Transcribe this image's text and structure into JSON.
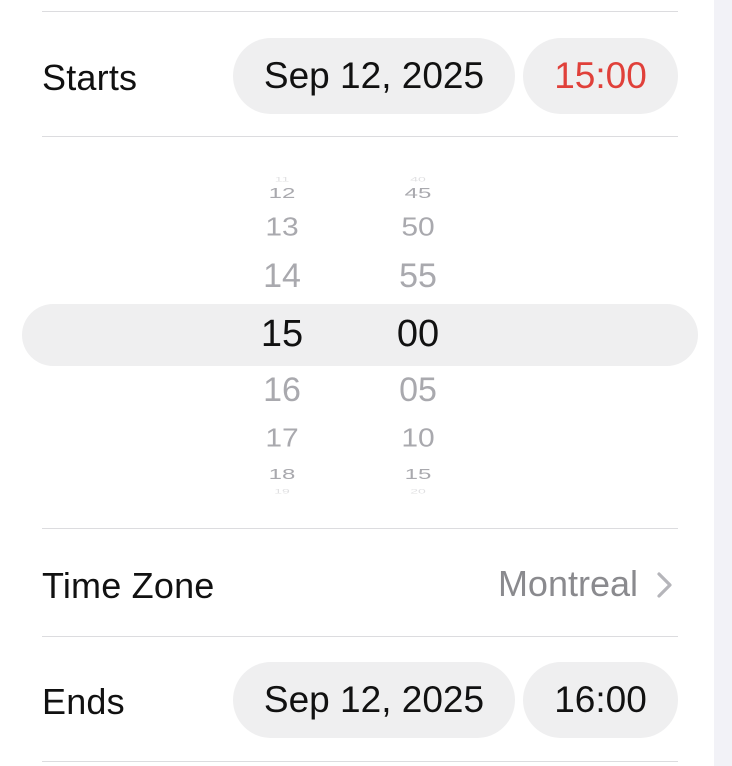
{
  "starts": {
    "label": "Starts",
    "date": "Sep 12, 2025",
    "time": "15:00"
  },
  "picker": {
    "hours": [
      "11",
      "12",
      "13",
      "14",
      "15",
      "16",
      "17",
      "18",
      "19"
    ],
    "minutes": [
      "40",
      "45",
      "50",
      "55",
      "00",
      "05",
      "10",
      "15",
      "20"
    ],
    "selected_hour": "15",
    "selected_minute": "00"
  },
  "time_zone": {
    "label": "Time Zone",
    "value": "Montreal"
  },
  "ends": {
    "label": "Ends",
    "date": "Sep 12, 2025",
    "time": "16:00"
  },
  "colors": {
    "accent": "#e0403a",
    "pill_background": "#efeff0",
    "secondary_text": "#8a8a8e"
  },
  "icons": {
    "time_zone_chevron": "chevron-right-icon"
  }
}
